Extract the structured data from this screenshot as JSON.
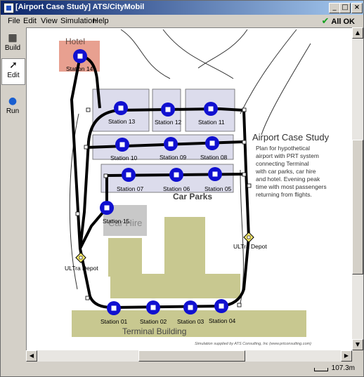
{
  "window": {
    "title": "[Airport Case Study] ATS/CityMobil"
  },
  "menu": [
    "File",
    "Edit",
    "View",
    "Simulation",
    "Help"
  ],
  "status": {
    "label": "All OK"
  },
  "tools": [
    {
      "label": "Build",
      "icon": "build-icon"
    },
    {
      "label": "Edit",
      "icon": "pointer-icon"
    },
    {
      "label": "Run",
      "icon": "play-icon"
    }
  ],
  "map": {
    "hotel_label": "Hotel",
    "car_hire_label": "Car Hire",
    "car_parks_label": "Car Parks",
    "terminal_label": "Terminal Building",
    "case_title": "Airport Case Study",
    "case_lines": [
      "Plan for hypothetical",
      "airport with PRT system",
      "connecting Terminal",
      "with car parks, car hire",
      "and hotel.  Evening peak",
      "time with most passengers",
      "returning from flights."
    ],
    "credit": "Simulation supplied by ATS Consulting, Inc (www.prtconsulting.com)",
    "stations": [
      "Station 14",
      "Station 13",
      "Station 12",
      "Station 11",
      "Station 10",
      "Station 09",
      "Station 08",
      "Station 07",
      "Station 06",
      "Station 05",
      "Station 15",
      "Station 01",
      "Station 02",
      "Station 03",
      "Station 04"
    ],
    "depots": [
      "ULTra Depot",
      "ULTra Depot"
    ]
  },
  "scale": {
    "label": "107.3m"
  },
  "colors": {
    "station": "#1010d0",
    "track": "#000000",
    "hotel": "#e8a090",
    "building": "#c8c890",
    "carpark": "#dcdcec"
  }
}
